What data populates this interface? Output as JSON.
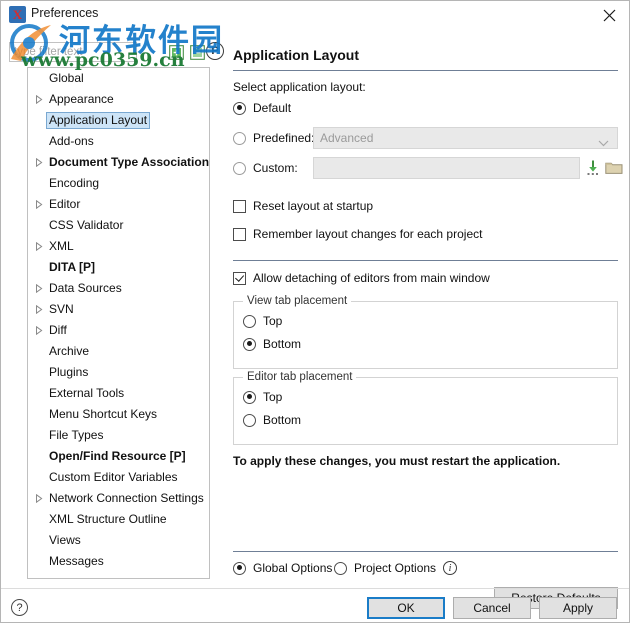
{
  "window": {
    "title": "Preferences",
    "app_icon": "oxygen-x-icon",
    "close_label": "✕"
  },
  "sidebar": {
    "filter": {
      "placeholder": "type filter text",
      "value": ""
    },
    "toolbar": {
      "expand_all": "expand-all-icon",
      "collapse_all": "collapse-all-icon",
      "project_badge": "P"
    },
    "items": [
      {
        "label": "Global",
        "expandable": false,
        "bold": false,
        "selected": false
      },
      {
        "label": "Appearance",
        "expandable": true,
        "bold": false,
        "selected": false
      },
      {
        "label": "Application Layout",
        "expandable": false,
        "bold": false,
        "selected": true
      },
      {
        "label": "Add-ons",
        "expandable": false,
        "bold": false,
        "selected": false
      },
      {
        "label": "Document Type Association [P]",
        "expandable": true,
        "bold": true,
        "selected": false
      },
      {
        "label": "Encoding",
        "expandable": false,
        "bold": false,
        "selected": false
      },
      {
        "label": "Editor",
        "expandable": true,
        "bold": false,
        "selected": false
      },
      {
        "label": "CSS Validator",
        "expandable": false,
        "bold": false,
        "selected": false
      },
      {
        "label": "XML",
        "expandable": true,
        "bold": false,
        "selected": false
      },
      {
        "label": "DITA [P]",
        "expandable": false,
        "bold": true,
        "selected": false
      },
      {
        "label": "Data Sources",
        "expandable": true,
        "bold": false,
        "selected": false
      },
      {
        "label": "SVN",
        "expandable": true,
        "bold": false,
        "selected": false
      },
      {
        "label": "Diff",
        "expandable": true,
        "bold": false,
        "selected": false
      },
      {
        "label": "Archive",
        "expandable": false,
        "bold": false,
        "selected": false
      },
      {
        "label": "Plugins",
        "expandable": false,
        "bold": false,
        "selected": false
      },
      {
        "label": "External Tools",
        "expandable": false,
        "bold": false,
        "selected": false
      },
      {
        "label": "Menu Shortcut Keys",
        "expandable": false,
        "bold": false,
        "selected": false
      },
      {
        "label": "File Types",
        "expandable": false,
        "bold": false,
        "selected": false
      },
      {
        "label": "Open/Find Resource [P]",
        "expandable": false,
        "bold": true,
        "selected": false
      },
      {
        "label": "Custom Editor Variables",
        "expandable": false,
        "bold": false,
        "selected": false
      },
      {
        "label": "Network Connection Settings",
        "expandable": true,
        "bold": false,
        "selected": false
      },
      {
        "label": "XML Structure Outline",
        "expandable": false,
        "bold": false,
        "selected": false
      },
      {
        "label": "Views",
        "expandable": false,
        "bold": false,
        "selected": false
      },
      {
        "label": "Messages",
        "expandable": false,
        "bold": false,
        "selected": false
      }
    ]
  },
  "main": {
    "title": "Application Layout",
    "select_layout_label": "Select application layout:",
    "layout_options": {
      "default": {
        "label": "Default",
        "checked": true
      },
      "predefined": {
        "label": "Predefined:",
        "checked": false,
        "value": "Advanced",
        "disabled": true
      },
      "custom": {
        "label": "Custom:",
        "checked": false,
        "value": "",
        "disabled": true
      }
    },
    "custom_icons": {
      "insert": "insert-layout-icon",
      "browse": "browse-folder-icon"
    },
    "checkboxes": [
      {
        "label": "Reset layout at startup",
        "checked": false
      },
      {
        "label": "Remember layout changes for each project",
        "checked": false
      },
      {
        "label": "Allow detaching of editors from main window",
        "checked": true
      }
    ],
    "view_tab_placement": {
      "title": "View tab placement",
      "options": [
        {
          "label": "Top",
          "checked": false
        },
        {
          "label": "Bottom",
          "checked": true
        }
      ]
    },
    "editor_tab_placement": {
      "title": "Editor tab placement",
      "options": [
        {
          "label": "Top",
          "checked": true
        },
        {
          "label": "Bottom",
          "checked": false
        }
      ]
    },
    "restart_note": "To apply these changes, you must restart the application.",
    "scope": {
      "global": {
        "label": "Global Options",
        "checked": true
      },
      "project": {
        "label": "Project Options",
        "checked": false
      },
      "info_icon": "i"
    },
    "restore_defaults": {
      "mnemonic": "R",
      "rest": "estore Defaults"
    }
  },
  "footer": {
    "help_icon": "?",
    "buttons": [
      {
        "label": "OK",
        "default": true
      },
      {
        "label": "Cancel",
        "default": false
      },
      {
        "label": "Apply",
        "default": false
      }
    ]
  },
  "watermark": {
    "chinese": "河东软件园",
    "url": "www.pc0359.cn"
  },
  "colors": {
    "accent": "#1a7cc7",
    "selection": "#cde4f7",
    "rule": "#6f7f96",
    "watermark_blue": "#1278c8",
    "watermark_green": "#1b7a34"
  }
}
